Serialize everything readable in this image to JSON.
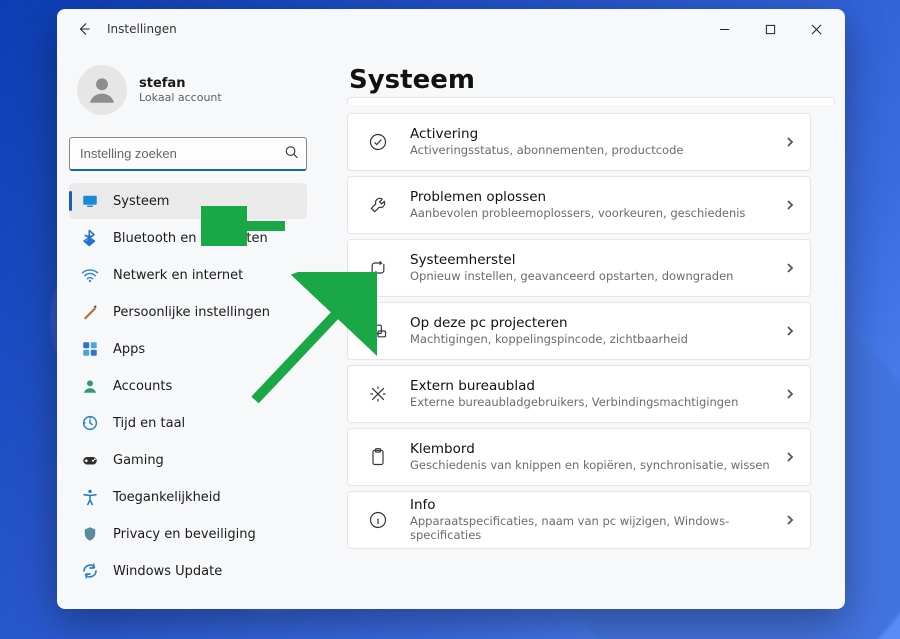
{
  "window": {
    "title": "Instellingen"
  },
  "profile": {
    "name": "stefan",
    "subtitle": "Lokaal account"
  },
  "search": {
    "placeholder": "Instelling zoeken"
  },
  "sidebar": {
    "selected_index": 0,
    "items": [
      {
        "id": "systeem",
        "label": "Systeem",
        "icon": "system"
      },
      {
        "id": "bluetooth",
        "label": "Bluetooth en apparaten",
        "icon": "bluetooth"
      },
      {
        "id": "network",
        "label": "Netwerk en internet",
        "icon": "network"
      },
      {
        "id": "personal",
        "label": "Persoonlijke instellingen",
        "icon": "personal"
      },
      {
        "id": "apps",
        "label": "Apps",
        "icon": "apps"
      },
      {
        "id": "accounts",
        "label": "Accounts",
        "icon": "accounts"
      },
      {
        "id": "time",
        "label": "Tijd en taal",
        "icon": "time"
      },
      {
        "id": "gaming",
        "label": "Gaming",
        "icon": "gaming"
      },
      {
        "id": "accessibility",
        "label": "Toegankelijkheid",
        "icon": "accessibility"
      },
      {
        "id": "privacy",
        "label": "Privacy en beveiliging",
        "icon": "privacy"
      },
      {
        "id": "update",
        "label": "Windows Update",
        "icon": "update"
      }
    ]
  },
  "page": {
    "title": "Systeem",
    "cards": [
      {
        "id": "activation",
        "icon": "activation",
        "title": "Activering",
        "subtitle": "Activeringsstatus, abonnementen, productcode"
      },
      {
        "id": "troubleshoot",
        "icon": "troubleshoot",
        "title": "Problemen oplossen",
        "subtitle": "Aanbevolen probleemoplossers, voorkeuren, geschiedenis"
      },
      {
        "id": "recovery",
        "icon": "recovery",
        "title": "Systeemherstel",
        "subtitle": "Opnieuw instellen, geavanceerd opstarten, downgraden"
      },
      {
        "id": "project",
        "icon": "project",
        "title": "Op deze pc projecteren",
        "subtitle": "Machtigingen, koppelingspincode, zichtbaarheid"
      },
      {
        "id": "remote",
        "icon": "remote",
        "title": "Extern bureaublad",
        "subtitle": "Externe bureaubladgebruikers, Verbindingsmachtigingen"
      },
      {
        "id": "clipboard",
        "icon": "clipboard",
        "title": "Klembord",
        "subtitle": "Geschiedenis van knippen en kopiëren, synchronisatie, wissen"
      },
      {
        "id": "about",
        "icon": "about",
        "title": "Info",
        "subtitle": "Apparaatspecificaties, naam van pc wijzigen, Windows-specificaties"
      }
    ]
  },
  "colors": {
    "accent": "#1e5cbf",
    "arrow": "#1aa846"
  }
}
